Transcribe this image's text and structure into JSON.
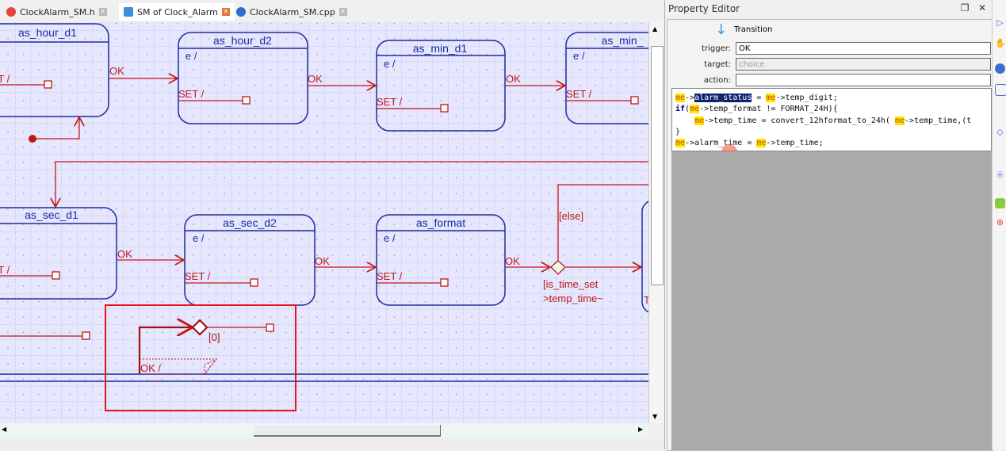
{
  "tabs": [
    {
      "label": "ClockAlarm_SM.h",
      "icon": "c-header-icon",
      "color": "#e8443b",
      "active": false
    },
    {
      "label": "SM of Clock_Alarm",
      "icon": "state-machine-icon",
      "color": "#3a8fd8",
      "active": true
    },
    {
      "label": "ClockAlarm_SM.cpp",
      "icon": "cpp-file-icon",
      "color": "#2a6fd0",
      "active": false
    }
  ],
  "diagram": {
    "states": [
      "as_hour_d1",
      "as_hour_d2",
      "as_min_d1",
      "as_min_",
      "as_sec_d1",
      "as_sec_d2",
      "as_format"
    ],
    "entry": "e /",
    "set_label": "SET /",
    "ok_label": "OK",
    "else_guard": "[else]",
    "choice_guard_1": "[is_time_set",
    "choice_guard_2": ">temp_time~",
    "partial_label": "T",
    "zero_guard": "[0]",
    "ok_action": "OK /"
  },
  "property_editor": {
    "title": "Property Editor",
    "kind": "Transition",
    "trigger_label": "trigger:",
    "trigger_value": "OK",
    "target_label": "target:",
    "target_value": "choice",
    "action_label": "action:",
    "action_value": "",
    "code": {
      "l1_a": "alarm_status",
      "l1_b": " = ",
      "l1_c": "->temp_digit;",
      "l2_kw": "if",
      "l2_a": "(",
      "l2_b": "->temp_format != FORMAT_24H){",
      "l3_a": "    ",
      "l3_b": "->temp_time = convert_12hformat_to_24h( ",
      "l3_c": "->temp_time,(t",
      "l4": "}",
      "l5_a": "->alarm_time = ",
      "l5_b": "->temp_time;",
      "me": "me",
      "arrow": "->"
    }
  },
  "colors": {
    "state": "#1c2ca0",
    "transition": "#c01818",
    "highlight": "#e8141a",
    "grid_bg": "#e6e6fd"
  }
}
